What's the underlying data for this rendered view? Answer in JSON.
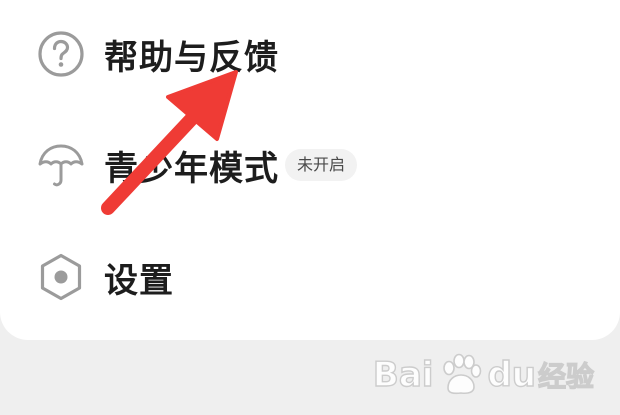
{
  "menu": {
    "items": [
      {
        "label": "帮助与反馈",
        "icon": "help-circle-icon"
      },
      {
        "label": "青少年模式",
        "icon": "umbrella-icon",
        "badge": "未开启"
      },
      {
        "label": "设置",
        "icon": "settings-hexagon-icon"
      }
    ]
  },
  "annotation": {
    "arrow_color": "#ef3b35"
  },
  "watermark": {
    "text_left": "Bai",
    "text_right": "du",
    "suffix": "经验"
  },
  "colors": {
    "card_background": "#ffffff",
    "page_background": "#efefef",
    "text_primary": "#1d1d1d",
    "icon_gray": "#9b9b9b",
    "badge_background": "#f2f2f2"
  }
}
